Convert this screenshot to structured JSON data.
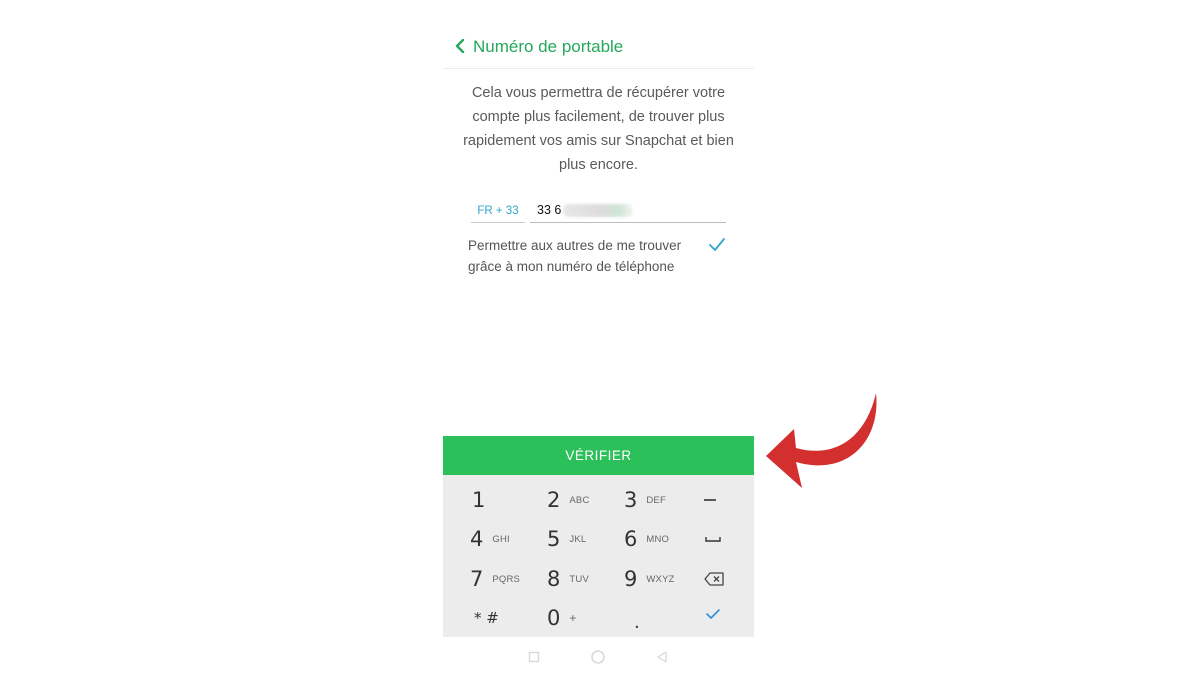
{
  "header": {
    "title": "Numéro de portable"
  },
  "description": "Cela vous permettra de récupérer votre compte plus facilement, de trouver plus rapidement vos amis sur Snapchat et bien plus encore.",
  "phone": {
    "country_code": "FR + 33",
    "number_visible": "33 6"
  },
  "permission": {
    "line1": "Permettre aux autres de me trouver",
    "line2": "grâce à mon numéro de téléphone",
    "checked": true
  },
  "verify_label": "VÉRIFIER",
  "keypad": {
    "keys": [
      {
        "num": "1",
        "sub": ""
      },
      {
        "num": "2",
        "sub": "ABC"
      },
      {
        "num": "3",
        "sub": "DEF"
      },
      {
        "num": "4",
        "sub": "GHI"
      },
      {
        "num": "5",
        "sub": "JKL"
      },
      {
        "num": "6",
        "sub": "MNO"
      },
      {
        "num": "7",
        "sub": "PQRS"
      },
      {
        "num": "8",
        "sub": "TUV"
      },
      {
        "num": "9",
        "sub": "WXYZ"
      },
      {
        "num": "* #",
        "sub": ""
      },
      {
        "num": "0",
        "sub": "+"
      },
      {
        "num": ".",
        "sub": ""
      }
    ],
    "side_keys": [
      "minus-key",
      "space-key",
      "backspace-key",
      "done-key"
    ]
  },
  "colors": {
    "brand_green": "#2cc05a",
    "header_green": "#24a85a",
    "accent_teal": "#2fa7c9",
    "annotation_red": "#d32f2f"
  }
}
